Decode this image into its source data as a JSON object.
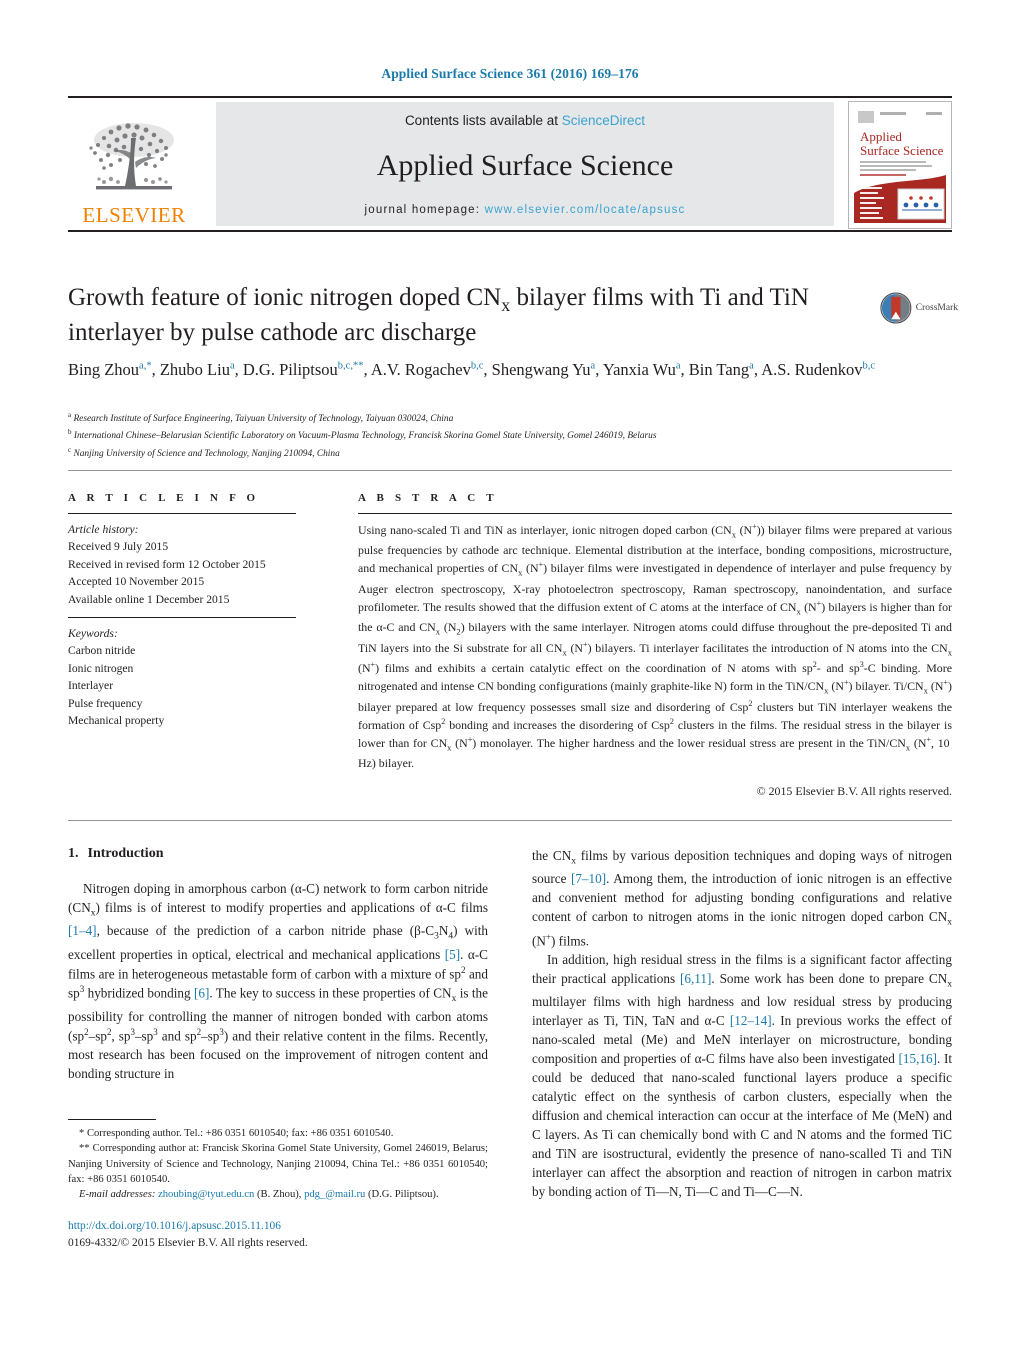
{
  "running_head": "Applied Surface Science 361 (2016) 169–176",
  "masthead": {
    "contents_prefix": "Contents lists available at ",
    "sciencedirect": "ScienceDirect",
    "journal_name": "Applied Surface Science",
    "homepage_prefix": "journal homepage: ",
    "homepage_url": "www.elsevier.com/locate/apsusc",
    "publisher": "ELSEVIER",
    "cover": {
      "title_line1": "Applied",
      "title_line2": "Surface Science",
      "color": "#a92822"
    }
  },
  "crossmark": {
    "label": "CrossMark"
  },
  "article": {
    "title_part1": "Growth feature of ionic nitrogen doped CN",
    "title_sub": "x",
    "title_part2": " bilayer films with Ti and TiN interlayer by pulse cathode arc discharge",
    "authors": [
      {
        "name": "Bing Zhou",
        "sup": "a,*"
      },
      {
        "name": "Zhubo Liu",
        "sup": "a"
      },
      {
        "name": "D.G. Piliptsou",
        "sup": "b,c,**"
      },
      {
        "name": "A.V. Rogachev",
        "sup": "b,c"
      },
      {
        "name": "Shengwang Yu",
        "sup": "a"
      },
      {
        "name": "Yanxia Wu",
        "sup": "a"
      },
      {
        "name": "Bin Tang",
        "sup": "a"
      },
      {
        "name": "A.S. Rudenkov",
        "sup": "b,c"
      }
    ],
    "affiliations": [
      {
        "mark": "a",
        "text": "Research Institute of Surface Engineering, Taiyuan University of Technology, Taiyuan 030024, China"
      },
      {
        "mark": "b",
        "text": "International Chinese–Belarusian Scientific Laboratory on Vacuum-Plasma Technology, Francisk Skorina Gomel State University, Gomel 246019, Belarus"
      },
      {
        "mark": "c",
        "text": "Nanjing University of Science and Technology, Nanjing 210094, China"
      }
    ]
  },
  "article_info": {
    "heading": "A R T I C L E   I N F O",
    "history_label": "Article history:",
    "history": [
      "Received 9 July 2015",
      "Received in revised form 12 October 2015",
      "Accepted 10 November 2015",
      "Available online 1 December 2015"
    ],
    "keywords_label": "Keywords:",
    "keywords": [
      "Carbon nitride",
      "Ionic nitrogen",
      "Interlayer",
      "Pulse frequency",
      "Mechanical property"
    ]
  },
  "abstract": {
    "heading": "A B S T R A C T",
    "paragraphs": [
      "Using nano-scaled Ti and TiN as interlayer, ionic nitrogen doped carbon (CNx (N+)) bilayer films were prepared at various pulse frequencies by cathode arc technique. Elemental distribution at the interface, bonding compositions, microstructure, and mechanical properties of CNx (N+) bilayer films were investigated in dependence of interlayer and pulse frequency by Auger electron spectroscopy, X-ray photoelectron spectroscopy, Raman spectroscopy, nanoindentation, and surface profilometer. The results showed that the diffusion extent of C atoms at the interface of CNx (N+) bilayers is higher than for the α-C and CNx (N2) bilayers with the same interlayer. Nitrogen atoms could diffuse throughout the pre-deposited Ti and TiN layers into the Si substrate for all CNx (N+) bilayers. Ti interlayer facilitates the introduction of N atoms into the CNx (N+) films and exhibits a certain catalytic effect on the coordination of N atoms with sp2- and sp3-C binding. More nitrogenated and intense CN bonding configurations (mainly graphite-like N) form in the TiN/CNx (N+) bilayer. Ti/CNx (N+) bilayer prepared at low frequency possesses small size and disordering of Csp2 clusters but TiN interlayer weakens the formation of Csp2 bonding and increases the disordering of Csp2 clusters in the films. The residual stress in the bilayer is lower than for CNx (N+) monolayer. The higher hardness and the lower residual stress are present in the TiN/CNx (N+, 10 Hz) bilayer."
    ],
    "copyright": "© 2015 Elsevier B.V. All rights reserved."
  },
  "body": {
    "section_number": "1.",
    "section_title": "Introduction",
    "left_paragraph": "Nitrogen doping in amorphous carbon (α-C) network to form carbon nitride (CNx) films is of interest to modify properties and applications of α-C films [1–4], because of the prediction of a carbon nitride phase (β-C3N4) with excellent properties in optical, electrical and mechanical applications [5]. α-C films are in heterogeneous metastable form of carbon with a mixture of sp2 and sp3 hybridized bonding [6]. The key to success in these properties of CNx is the possibility for controlling the manner of nitrogen bonded with carbon atoms (sp2–sp2, sp3–sp3 and sp2–sp3) and their relative content in the films. Recently, most research has been focused on the improvement of nitrogen content and bonding structure in",
    "right_paragraph_1": "the CNx films by various deposition techniques and doping ways of nitrogen source [7–10]. Among them, the introduction of ionic nitrogen is an effective and convenient method for adjusting bonding configurations and relative content of carbon to nitrogen atoms in the ionic nitrogen doped carbon CNx (N+) films.",
    "right_paragraph_2": "In addition, high residual stress in the films is a significant factor affecting their practical applications [6,11]. Some work has been done to prepare CNx multilayer films with high hardness and low residual stress by producing interlayer as Ti, TiN, TaN and α-C [12–14]. In previous works the effect of nano-scaled metal (Me) and MeN interlayer on microstructure, bonding composition and properties of α-C films have also been investigated [15,16]. It could be deduced that nano-scaled functional layers produce a specific catalytic effect on the synthesis of carbon clusters, especially when the diffusion and chemical interaction can occur at the interface of Me (MeN) and C layers. As Ti can chemically bond with C and N atoms and the formed TiC and TiN are isostructural, evidently the presence of nano-scalled Ti and TiN interlayer can affect the absorption and reaction of nitrogen in carbon matrix by bonding action of Ti—N, Ti—C and Ti—C—N."
  },
  "footnotes": {
    "line1": "* Corresponding author. Tel.: +86 0351 6010540; fax: +86 0351 6010540.",
    "line2": "** Corresponding author at: Francisk Skorina Gomel State University, Gomel 246019, Belarus; Nanjing University of Science and Technology, Nanjing 210094, China Tel.: +86 0351 6010540; fax: +86 0351 6010540.",
    "email_label": "E-mail addresses:",
    "email1": "zhoubing@tyut.edu.cn",
    "email1_owner": "(B. Zhou),",
    "email2": "pdg_@mail.ru",
    "email2_owner": "(D.G. Piliptsou)."
  },
  "doi_block": {
    "doi": "http://dx.doi.org/10.1016/j.apsusc.2015.11.106",
    "issn": "0169-4332/© 2015 Elsevier B.V. All rights reserved."
  },
  "colors": {
    "link": "#1a7aab",
    "sciencedirect": "#3aa3d0",
    "elsevier_orange": "#f08100",
    "cover_red": "#a92822",
    "band_gray": "#e6e7e8"
  }
}
